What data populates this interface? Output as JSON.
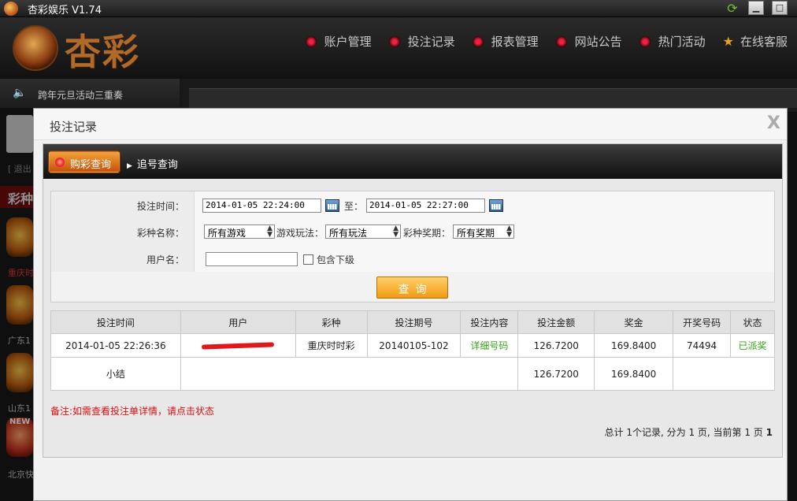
{
  "app": {
    "title": "杏彩娱乐 V1.74",
    "logo_text": "杏彩"
  },
  "nav": [
    {
      "label": "账户管理"
    },
    {
      "label": "投注记录"
    },
    {
      "label": "报表管理"
    },
    {
      "label": "网站公告"
    },
    {
      "label": "热门活动"
    },
    {
      "label": "在线客服"
    }
  ],
  "sidebar": {
    "marquee": "跨年元旦活动三重奏",
    "logout": "[ 退出",
    "section_tag": "彩种",
    "games": [
      "重庆时",
      "广东1",
      "山东1",
      "北京快"
    ],
    "badge_new": "NEW"
  },
  "dialog": {
    "title": "投注记录",
    "close": "X",
    "tabs": {
      "active": "购彩查询",
      "other": "追号查询"
    },
    "form": {
      "time_label": "投注时间：",
      "time_from": "2014-01-05 22:24:00",
      "to_label": "至：",
      "time_to": "2014-01-05 22:27:00",
      "lottery_label": "彩种名称：",
      "lottery_value": "所有游戏",
      "play_label": "游戏玩法：",
      "play_value": "所有玩法",
      "period_label": "彩种奖期：",
      "period_value": "所有奖期",
      "user_label": "用户名：",
      "user_value": "",
      "include_sub_label": "包含下级",
      "search_button": "查询"
    },
    "table": {
      "headers": [
        "投注时间",
        "用户",
        "彩种",
        "投注期号",
        "投注内容",
        "投注金额",
        "奖金",
        "开奖号码",
        "状态"
      ],
      "row": {
        "time": "2014-01-05 22:26:36",
        "lottery": "重庆时时彩",
        "period": "20140105-102",
        "content": "详细号码",
        "amount": "126.7200",
        "prize": "169.8400",
        "draw": "74494",
        "status": "已派奖"
      },
      "subtotal": {
        "label": "小结",
        "amount": "126.7200",
        "prize": "169.8400"
      }
    },
    "note": "备注:如需查看投注单详情，请点击状态",
    "pager": {
      "text": "总计 1个记录, 分为 1 页, 当前第 1 页",
      "current": "1"
    }
  },
  "colors": {
    "accent_orange": "#f09a12",
    "status_green": "#3aa318",
    "note_red": "#d11111"
  }
}
